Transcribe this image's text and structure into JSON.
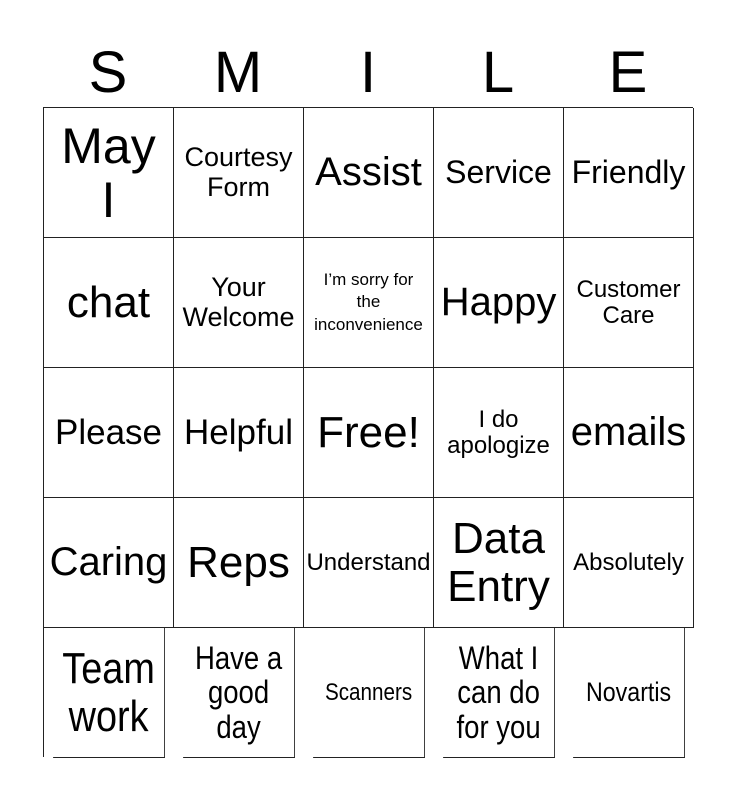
{
  "title_letters": [
    "S",
    "M",
    "I",
    "L",
    "E"
  ],
  "cells": [
    [
      "May\nI",
      "Courtesy\nForm",
      "Assist",
      "Service",
      "Friendly"
    ],
    [
      "chat",
      "Your\nWelcome",
      "I’m sorry for\nthe\ninconvenience",
      "Happy",
      "Customer\nCare"
    ],
    [
      "Please",
      "Helpful",
      "Free!",
      "I do\napologize",
      "emails"
    ],
    [
      "Caring",
      "Reps",
      "Understand",
      "Data\nEntry",
      "Absolutely"
    ],
    [
      "Team\nwork",
      "Have a\ngood\nday",
      "Scanners",
      "What I\ncan do\nfor you",
      "Novartis"
    ]
  ]
}
